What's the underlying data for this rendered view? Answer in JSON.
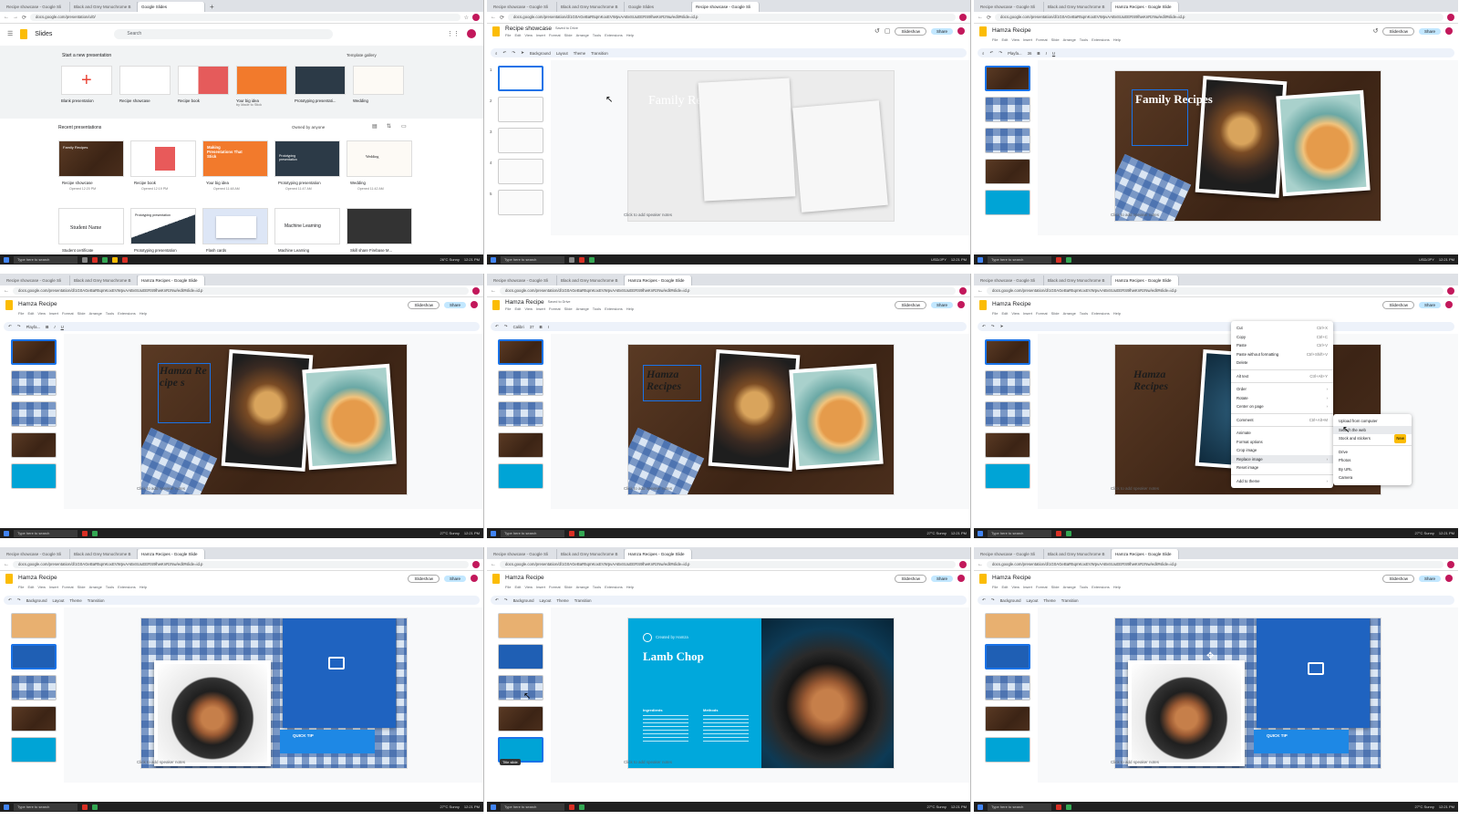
{
  "browser": {
    "tabs": [
      "Recipe showcase - Google Sli",
      "Black and Grey Monochrome B",
      "Google Slides",
      "Hamza Recipes - Google Slide"
    ],
    "url_home": "docs.google.com/presentation/u/0/",
    "url_pres": "docs.google.com/presentation/d/1G0AGeBaR5qmKoxEVWpvAABvSUuEERS9lhwKnRzNw/edit#slide=id.p"
  },
  "home": {
    "app_name": "Slides",
    "search_placeholder": "Search",
    "start_new": "Start a new presentation",
    "template_gallery": "Template gallery",
    "templates": [
      {
        "label": "Blank presentation",
        "sub": ""
      },
      {
        "label": "Recipe showcase",
        "sub": ""
      },
      {
        "label": "Recipe book",
        "sub": ""
      },
      {
        "label": "Your big idea",
        "sub": "by Made to Stick"
      },
      {
        "label": "Prototyping presentati...",
        "sub": ""
      },
      {
        "label": "Wedding",
        "sub": ""
      }
    ],
    "recent": "Recent presentations",
    "owned_by": "Owned by anyone",
    "recent_items": [
      {
        "label": "Recipe showcase",
        "sub": "Opened 12:20 PM",
        "thumb_text": "Family Recipes"
      },
      {
        "label": "Recipe book",
        "sub": "Opened 12:19 PM",
        "thumb_text": ""
      },
      {
        "label": "Your big idea",
        "sub": "Opened 11:48 AM",
        "thumb_text": "Making Presentations That Stick"
      },
      {
        "label": "Prototyping presentation",
        "sub": "Opened 11:47 AM",
        "thumb_text": "Prototyping presentation"
      },
      {
        "label": "Wedding",
        "sub": "Opened 11:42 AM",
        "thumb_text": "Wedding"
      },
      {
        "label": "Student certificate",
        "sub": "",
        "thumb_text": "Student Name"
      },
      {
        "label": "Prototyping presentation",
        "sub": "",
        "thumb_text": "Prototyping presentation"
      },
      {
        "label": "Flash cards",
        "sub": "",
        "thumb_text": ""
      },
      {
        "label": "Machine Learning",
        "sub": "",
        "thumb_text": "Machine Learning"
      },
      {
        "label": "Skill share Firebase M...",
        "sub": "",
        "thumb_text": ""
      }
    ]
  },
  "pres": {
    "title_showcase": "Recipe showcase",
    "title_hamza": "Hamza Recipe",
    "saved": "Saved to Drive",
    "menus": [
      "File",
      "Edit",
      "View",
      "Insert",
      "Format",
      "Slide",
      "Arrange",
      "Tools",
      "Extensions",
      "Help"
    ],
    "slideshow": "Slideshow",
    "share": "Share",
    "toolbar_text": [
      "Background",
      "Layout",
      "Theme",
      "Transition"
    ],
    "font_playfair": "Playfa...",
    "font_calibri": "Calibri",
    "font_size_36": "36",
    "font_size_37": "37",
    "notes": "Click to add speaker notes",
    "title_family": "Family Recipes",
    "title_hamza_broken": "Hamza Recipe s",
    "title_hamza_full": "Hamza Recipes",
    "lamb_title": "Lamb Chop",
    "lamb_author": "Created by Hamza",
    "lamb_col1": "Ingredients",
    "lamb_col2": "Methods",
    "quick_tip": "QUICK TIP",
    "tooltip_new": "Title slide",
    "context_menu": [
      {
        "label": "Cut",
        "sc": "Ctrl+X"
      },
      {
        "label": "Copy",
        "sc": "Ctrl+C"
      },
      {
        "label": "Paste",
        "sc": "Ctrl+V"
      },
      {
        "label": "Paste without formatting",
        "sc": "Ctrl+Shift+V"
      },
      {
        "label": "Delete",
        "sc": ""
      },
      {
        "label": "Alt text",
        "sc": "Ctrl+Alt+Y"
      },
      {
        "label": "Order",
        "sc": "›"
      },
      {
        "label": "Rotate",
        "sc": "›"
      },
      {
        "label": "Center on page",
        "sc": "›"
      },
      {
        "label": "Comment",
        "sc": "Ctrl+Alt+M"
      },
      {
        "label": "Animate",
        "sc": ""
      },
      {
        "label": "Format options",
        "sc": ""
      },
      {
        "label": "Crop image",
        "sc": ""
      },
      {
        "label": "Replace image",
        "sc": "›"
      },
      {
        "label": "Reset image",
        "sc": ""
      },
      {
        "label": "Add to theme",
        "sc": "›"
      }
    ],
    "submenu": [
      "Upload from computer",
      "Search the web",
      "Stock and stickers",
      "Drive",
      "Photos",
      "By URL",
      "Camera"
    ],
    "submenu_badge": "New"
  },
  "taskbar": {
    "search": "Type here to search",
    "weather_a": "26°C Sunny",
    "weather_b": "27°C Sunny",
    "ticker": "USD/JPY",
    "time": "12:21 PM",
    "date": "11/1/2024"
  }
}
